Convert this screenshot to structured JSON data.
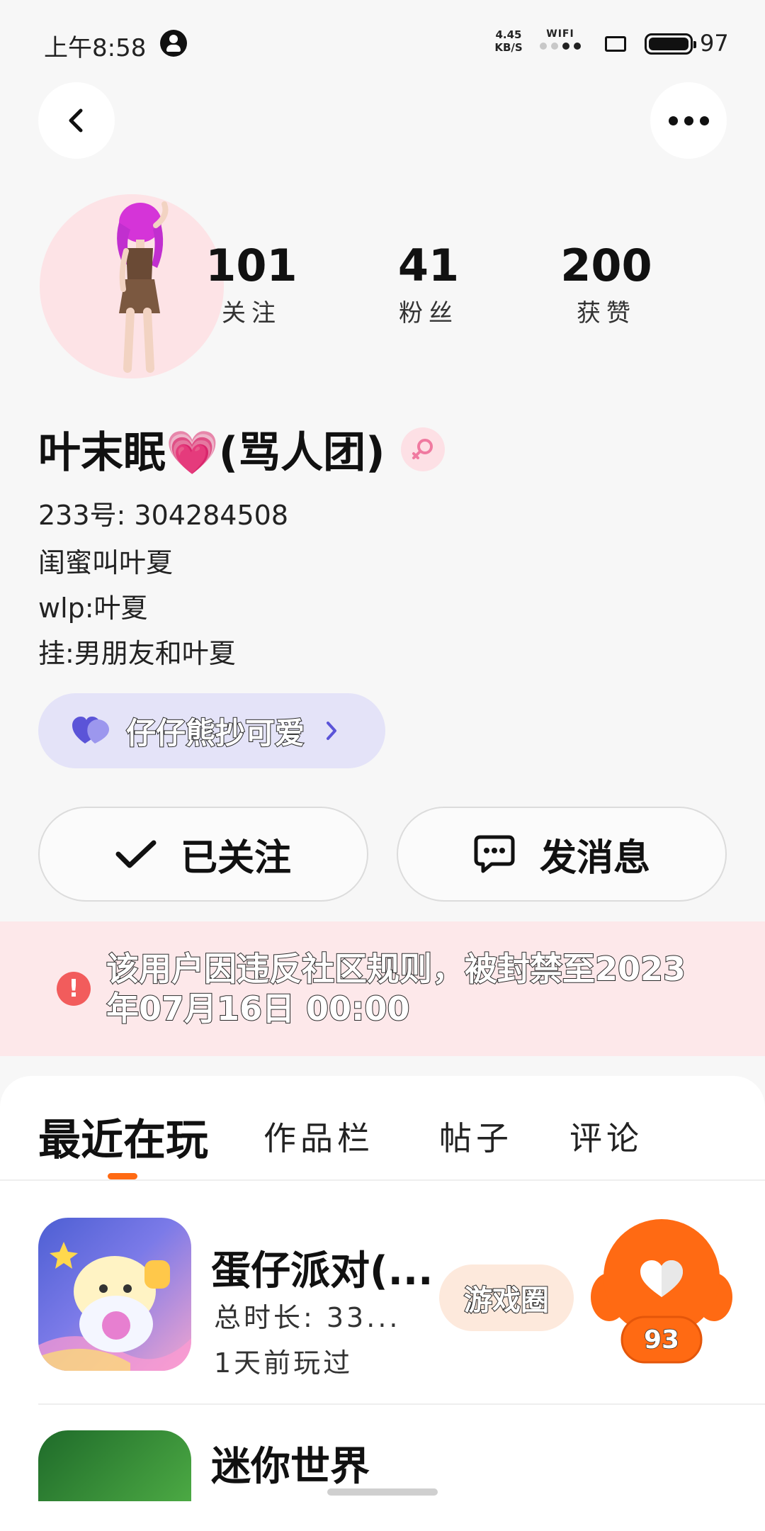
{
  "status_bar": {
    "time": "上午8:58",
    "net_speed_value": "4.45",
    "net_speed_unit": "KB/S",
    "wifi_label": "WIFI",
    "battery": "97"
  },
  "stats": {
    "follow_count": "101",
    "follow_label": "关注",
    "fans_count": "41",
    "fans_label": "粉丝",
    "likes_count": "200",
    "likes_label": "获赞"
  },
  "profile": {
    "username": "叶末眠💗(骂人团)",
    "account_id": "233号:  304284508",
    "bio_lines": [
      "闺蜜叫叶夏",
      "wlp:叶夏",
      "挂:男朋友和叶夏"
    ]
  },
  "group": {
    "label": "仔仔熊抄可爱"
  },
  "actions": {
    "follow_label": "已关注",
    "message_label": "发消息"
  },
  "ban_notice": {
    "text": "该用户因违反社区规则，被封禁至2023年07月16日 00:00"
  },
  "tabs": [
    {
      "label": "最近在玩"
    },
    {
      "label": "作品栏"
    },
    {
      "label": "帖子"
    },
    {
      "label": "评论"
    }
  ],
  "games": [
    {
      "name": "蛋仔派对(...",
      "duration": "总时长:  33...",
      "last_played": "1天前玩过",
      "circle_label": "游戏圈",
      "like_count": "93"
    },
    {
      "name": "迷你世界"
    }
  ],
  "colors": {
    "accent": "#ff6a13",
    "ban_background": "#fde8ea",
    "group_pill": "#e4e3f8",
    "avatar_background": "#fde3e6"
  },
  "icons": {
    "back": "chevron-left-icon",
    "more": "more-dots-icon",
    "gender": "female-icon",
    "group": "heart-icon",
    "follow": "checkmark-icon",
    "message": "chat-bubble-icon",
    "ban": "alert-icon",
    "like": "heart-icon"
  }
}
